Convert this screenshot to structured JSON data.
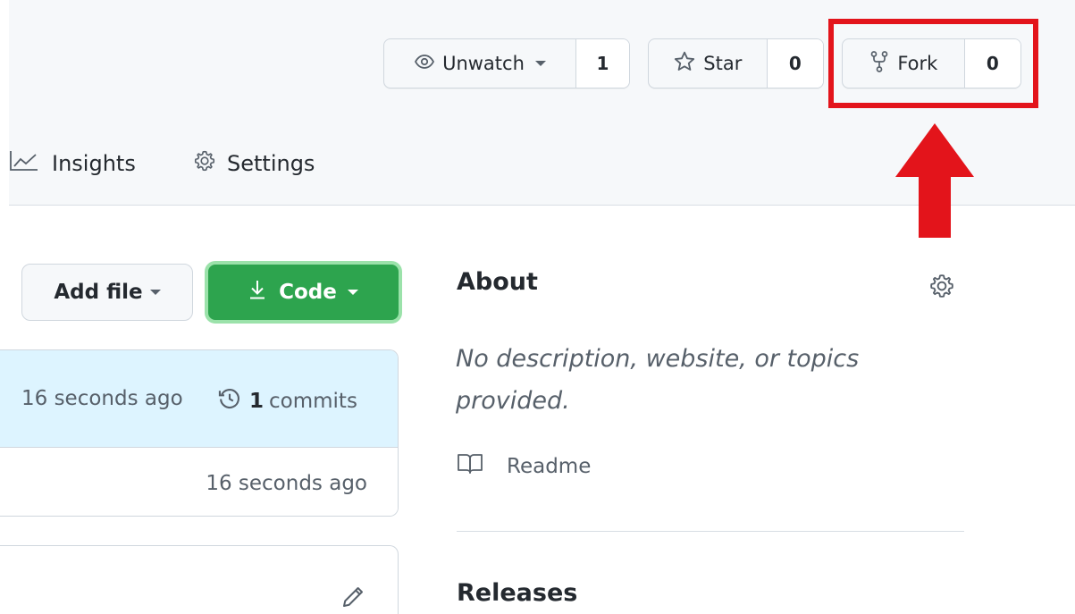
{
  "repo_actions": {
    "watch": {
      "label": "Unwatch",
      "count": "1"
    },
    "star": {
      "label": "Star",
      "count": "0"
    },
    "fork": {
      "label": "Fork",
      "count": "0"
    }
  },
  "tabs": [
    {
      "label": "Insights"
    },
    {
      "label": "Settings"
    }
  ],
  "file_actions": {
    "add_file_label": "Add file",
    "code_label": "Code"
  },
  "latest_commit": {
    "time": "16 seconds ago",
    "commit_count": "1",
    "commit_word": "commits"
  },
  "file_row": {
    "time": "16 seconds ago"
  },
  "about": {
    "title": "About",
    "description": "No description, website, or topics provided.",
    "readme_label": "Readme"
  },
  "releases": {
    "title": "Releases"
  },
  "colors": {
    "highlight": "#e3141b",
    "code_button": "#2da44e",
    "commit_header": "#ddf4ff"
  }
}
